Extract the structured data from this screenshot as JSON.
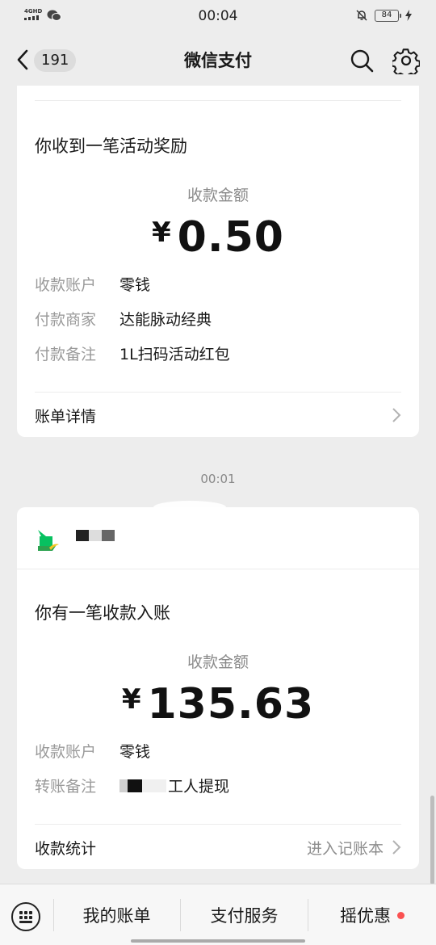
{
  "status_bar": {
    "network": "4GHD",
    "time": "00:04",
    "battery": "84"
  },
  "nav": {
    "back_badge": "191",
    "title": "微信支付"
  },
  "card1": {
    "heading": "你收到一笔活动奖励",
    "amount_label": "收款金额",
    "currency": "¥",
    "amount": "0.50",
    "rows": [
      {
        "key": "收款账户",
        "value": "零钱"
      },
      {
        "key": "付款商家",
        "value": "达能脉动经典"
      },
      {
        "key": "付款备注",
        "value": "1L扫码活动红包"
      }
    ],
    "footer_label": "账单详情"
  },
  "timestamp": "00:01",
  "card2": {
    "heading": "你有一笔收款入账",
    "amount_label": "收款金额",
    "currency": "¥",
    "amount": "135.63",
    "rows": [
      {
        "key": "收款账户",
        "value": "零钱"
      },
      {
        "key": "转账备注",
        "value": "工人提现"
      }
    ],
    "footer_label": "收款统计",
    "footer_link": "进入记账本"
  },
  "bottom_bar": {
    "items": [
      "我的账单",
      "支付服务",
      "摇优惠"
    ]
  },
  "colors": {
    "background": "#ededed",
    "card": "#ffffff",
    "label_gray": "#9a9a9a",
    "badge_red": "#fa5151",
    "merchant_green": "#07c160"
  }
}
